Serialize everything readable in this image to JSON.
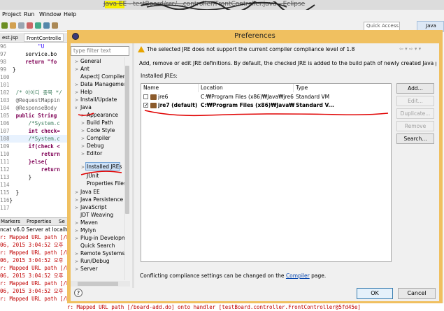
{
  "window": {
    "title": "Java EE - testBoard/src/...controller/FrontController.java - Eclipse",
    "menu": [
      "Project",
      "Run",
      "Window",
      "Help"
    ],
    "quick_access": "Quick Access",
    "perspective": "Java EE"
  },
  "editor": {
    "tabs": [
      "est.jsp",
      "FrontControlle"
    ],
    "lines": [
      {
        "num": "96",
        "text": "          \"U"
      },
      {
        "num": "97",
        "text": "      service.bo"
      },
      {
        "num": "98",
        "text": "      return \"fo"
      },
      {
        "num": "99",
        "text": "  }"
      },
      {
        "num": "100",
        "text": ""
      },
      {
        "num": "101",
        "text": ""
      },
      {
        "num": "102",
        "text": "  /* 아이디 중복 */"
      },
      {
        "num": "103",
        "text": "  @RequestMappin"
      },
      {
        "num": "104",
        "text": "  @ResponseBody"
      },
      {
        "num": "105",
        "text": "  public String"
      },
      {
        "num": "106",
        "text": "      /*System.c"
      },
      {
        "num": "107",
        "text": "      int check="
      },
      {
        "num": "108",
        "text": "      /*System.c"
      },
      {
        "num": "109",
        "text": "      if(check <"
      },
      {
        "num": "110",
        "text": "          return"
      },
      {
        "num": "111",
        "text": "      }else{"
      },
      {
        "num": "112",
        "text": "          return"
      },
      {
        "num": "113",
        "text": "      }"
      },
      {
        "num": "114",
        "text": ""
      },
      {
        "num": "115",
        "text": "  }"
      },
      {
        "num": "116",
        "text": "}"
      },
      {
        "num": "117",
        "text": ""
      }
    ]
  },
  "console": {
    "tabs": [
      "Markers",
      "Properties",
      "Se"
    ],
    "header": "ncat v6.0 Server at localhost",
    "lines": [
      "r: Mapped URL path [/b",
      "06, 2015 3:04:52 오후",
      "r: Mapped URL path [/b",
      "06, 2015 3:04:52 오후",
      "r: Mapped URL path [/b",
      "06, 2015 3:04:52 오후",
      "r: Mapped URL path [/b",
      "06, 2015 3:04:52 오후",
      "r: Mapped URL path [/b"
    ],
    "bottom_line": "r: Mapped URL path [/board-add.do] onto handler [testBoard.controller.FrontController@5fd45e]"
  },
  "dialog": {
    "title": "Preferences",
    "filter_placeholder": "type filter text",
    "tree": [
      {
        "label": "General",
        "level": 0,
        "twisty": ">"
      },
      {
        "label": "Ant",
        "level": 0,
        "twisty": ">"
      },
      {
        "label": "AspectJ Compiler",
        "level": 0,
        "twisty": ""
      },
      {
        "label": "Data Managemen",
        "level": 0,
        "twisty": ">"
      },
      {
        "label": "Help",
        "level": 0,
        "twisty": ">"
      },
      {
        "label": "Install/Update",
        "level": 0,
        "twisty": ">"
      },
      {
        "label": "Java",
        "level": 0,
        "twisty": "v"
      },
      {
        "label": "Appearance",
        "level": 1,
        "twisty": ">"
      },
      {
        "label": "Build Path",
        "level": 1,
        "twisty": ">"
      },
      {
        "label": "Code Style",
        "level": 1,
        "twisty": ">"
      },
      {
        "label": "Compiler",
        "level": 1,
        "twisty": ">"
      },
      {
        "label": "Debug",
        "level": 1,
        "twisty": ">"
      },
      {
        "label": "Editor",
        "level": 1,
        "twisty": ">"
      },
      {
        "label": "Installed JREs",
        "level": 1,
        "twisty": ">"
      },
      {
        "label": "JUnit",
        "level": 1,
        "twisty": ""
      },
      {
        "label": "Properties Files",
        "level": 1,
        "twisty": ""
      },
      {
        "label": "Java EE",
        "level": 0,
        "twisty": ">"
      },
      {
        "label": "Java Persistence",
        "level": 0,
        "twisty": ">"
      },
      {
        "label": "JavaScript",
        "level": 0,
        "twisty": ">"
      },
      {
        "label": "JDT Weaving",
        "level": 0,
        "twisty": ""
      },
      {
        "label": "Maven",
        "level": 0,
        "twisty": ">"
      },
      {
        "label": "Mylyn",
        "level": 0,
        "twisty": ">"
      },
      {
        "label": "Plug-in Developm",
        "level": 0,
        "twisty": ">"
      },
      {
        "label": "Quick Search",
        "level": 0,
        "twisty": ""
      },
      {
        "label": "Remote Systems",
        "level": 0,
        "twisty": ">"
      },
      {
        "label": "Run/Debug",
        "level": 0,
        "twisty": ">"
      },
      {
        "label": "Server",
        "level": 0,
        "twisty": ">"
      }
    ],
    "warning": "The selected JRE does not support the current compiler compliance level of 1.8",
    "nav_arrows": "⇦ ▾ ⇨ ▾ ▾",
    "description": "Add, remove or edit JRE definitions. By default, the checked JRE is added to the build path of newly created Java projects.",
    "installed_label": "Installed JREs:",
    "columns": [
      "Name",
      "Location",
      "Type"
    ],
    "jres": [
      {
        "name": "jre6",
        "location": "C:₩Program Files (x86)₩Java₩jre6",
        "type": "Standard VM",
        "checked": false,
        "bold": false
      },
      {
        "name": "jre7 (default)",
        "location": "C:₩Program Files (x86)₩Java₩jre7",
        "type": "Standard V...",
        "checked": true,
        "bold": true
      }
    ],
    "buttons": {
      "add": "Add...",
      "edit": "Edit...",
      "duplicate": "Duplicate...",
      "remove": "Remove",
      "search": "Search..."
    },
    "conflict_prefix": "Conflicting compliance settings can be changed on the",
    "conflict_link": "Compiler",
    "conflict_suffix": "page.",
    "help": "?",
    "ok": "OK",
    "cancel": "Cancel"
  },
  "colors": {
    "dialog_frame": "#f0c060",
    "annotation": "#e00000",
    "link": "#0645ad"
  }
}
